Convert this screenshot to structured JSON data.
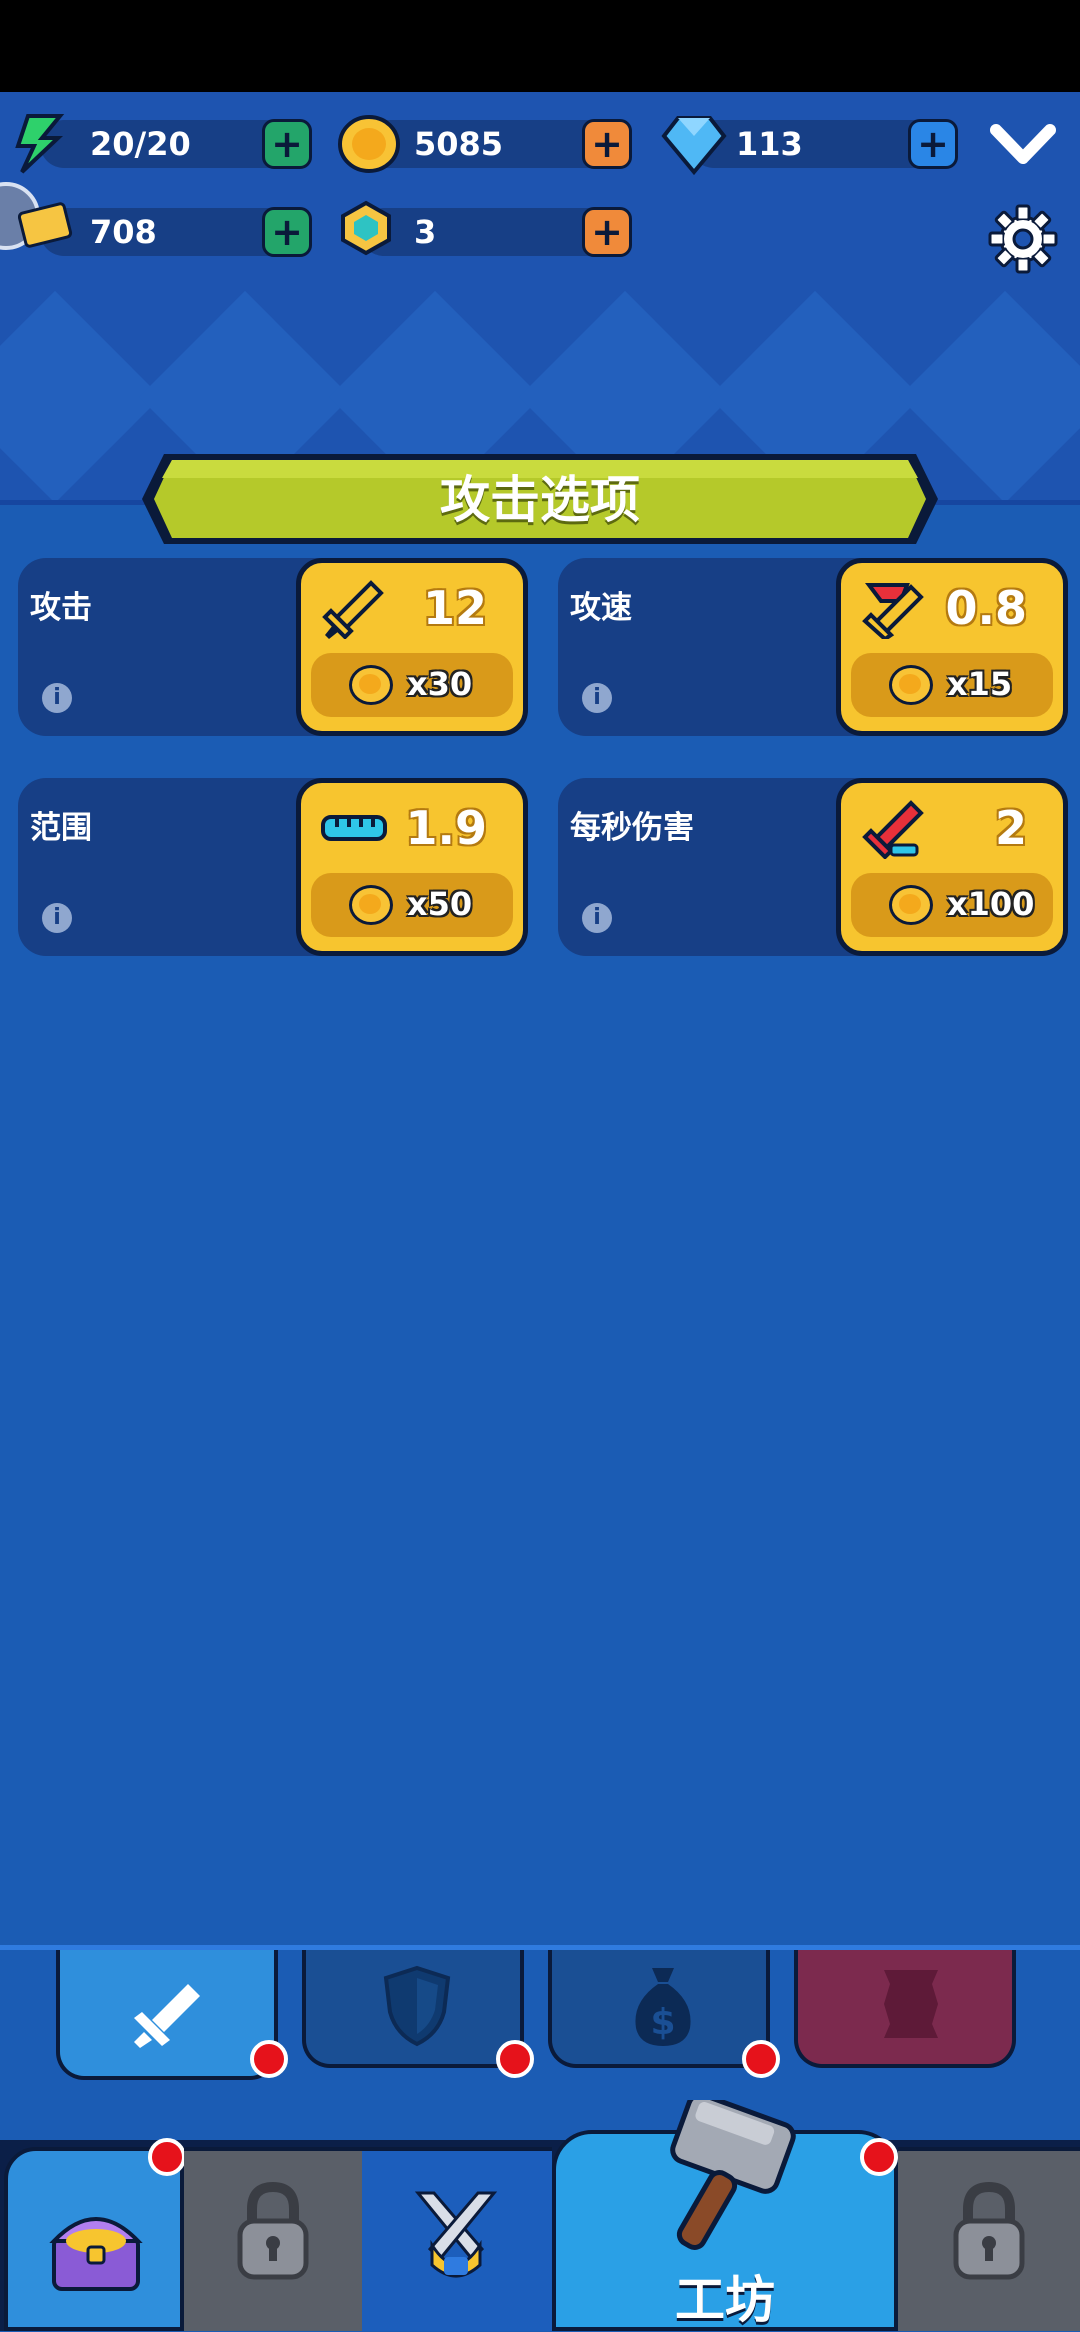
{
  "resources": {
    "energy": {
      "value": "20/20",
      "icon": "lightning-icon"
    },
    "gold": {
      "value": "5085",
      "icon": "gold-coin-icon"
    },
    "gems": {
      "value": "113",
      "icon": "blue-gem-icon"
    },
    "tickets": {
      "value": "708",
      "icon": "ticket-icon"
    },
    "tokens": {
      "value": "3",
      "icon": "hex-token-icon"
    }
  },
  "panel_title": "攻击选项",
  "upgrades": [
    {
      "label": "攻击",
      "value": "12",
      "cost": "x30",
      "icon": "sword-icon"
    },
    {
      "label": "攻速",
      "value": "0.8",
      "cost": "x15",
      "icon": "speed-sword-icon"
    },
    {
      "label": "范围",
      "value": "1.9",
      "cost": "x50",
      "icon": "ruler-icon"
    },
    {
      "label": "每秒伤害",
      "value": "2",
      "cost": "x100",
      "icon": "dps-sword-icon"
    }
  ],
  "category_tabs": [
    "sword-icon",
    "shield-icon",
    "money-bag-icon",
    "scroll-icon"
  ],
  "nav": {
    "workshop_label": "工坊"
  },
  "colors": {
    "accent_gold": "#f7c52f",
    "banner_green": "#b5c92a",
    "background_blue": "#1b5cb4",
    "notification_red": "#e6121b"
  }
}
